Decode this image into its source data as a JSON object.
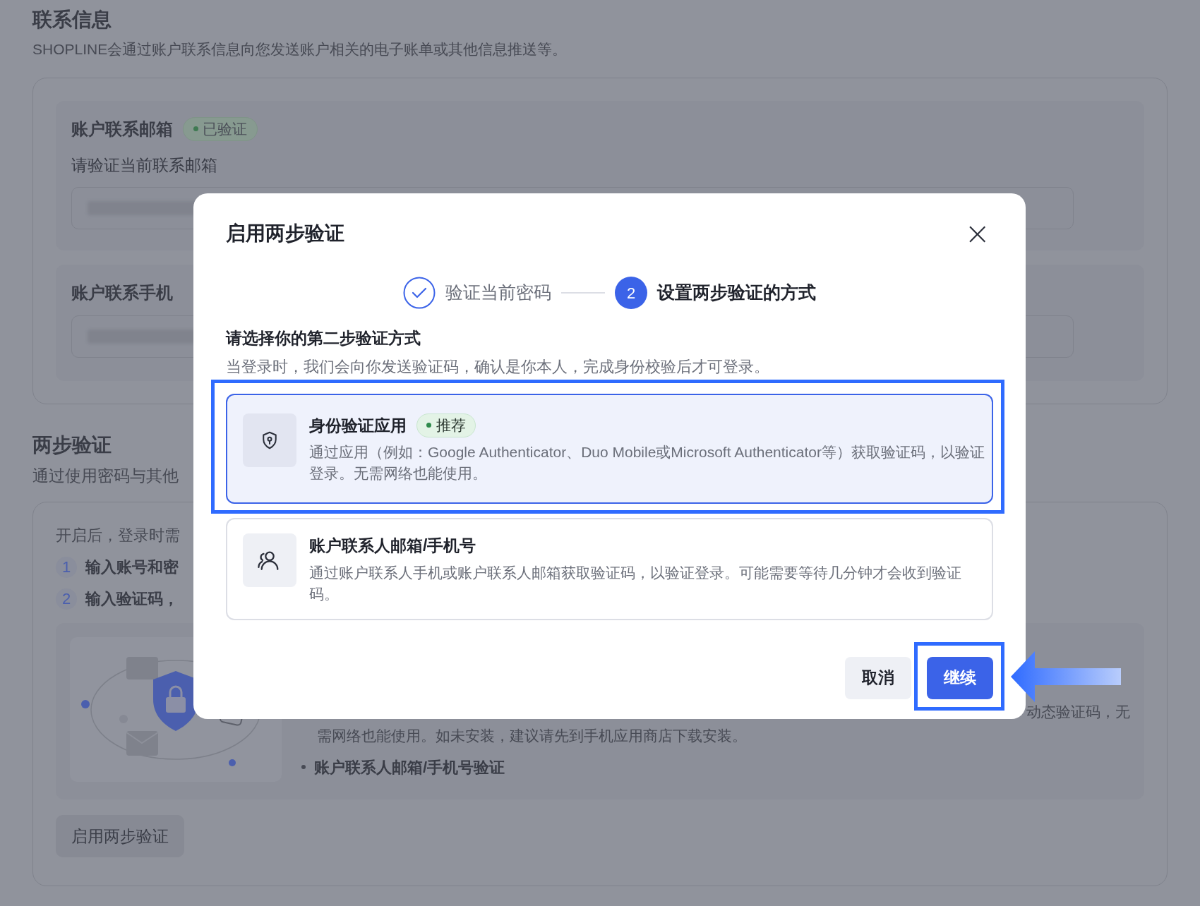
{
  "page": {
    "contact": {
      "title": "联系信息",
      "subtitle": "SHOPLINE会通过账户联系信息向您发送账户相关的电子账单或其他信息推送等。",
      "email": {
        "label": "账户联系邮箱",
        "badge": {
          "text": "已验证",
          "color": "#3f7a52"
        },
        "hint": "请验证当前联系邮箱"
      },
      "phone": {
        "label": "账户联系手机"
      }
    },
    "two_step": {
      "title": "两步验证",
      "subtitle": "通过使用密码与其他",
      "intro": "开启后，登录时需",
      "steps": [
        {
          "number": "1",
          "text": "输入账号和密"
        },
        {
          "number": "2",
          "text": "输入验证码，"
        }
      ],
      "methods_text_1": "动态验证码，无",
      "methods_text_2": "需网络也能使用。如未安装，建议请先到手机应用商店下载安装。",
      "methods_bullet": "账户联系人邮箱/手机号验证",
      "button": "启用两步验证"
    }
  },
  "dialog": {
    "title": "启用两步验证",
    "close": "×",
    "steps": [
      {
        "label": "验证当前密码",
        "kind": "done"
      },
      {
        "number": "2",
        "label": "设置两步验证的方式",
        "kind": "current"
      }
    ],
    "prompt": "请选择你的第二步验证方式",
    "description": "当登录时，我们会向你发送验证码，确认是你本人，完成身份校验后才可登录。",
    "options": [
      {
        "kind": "shield",
        "title": "身份验证应用",
        "badge": {
          "text": "推荐",
          "color": "#2f8a4c"
        },
        "description": "通过应用（例如：Google Authenticator、Duo Mobile或Microsoft Authenticator等）获取验证码，以验证登录。无需网络也能使用。",
        "selected": true
      },
      {
        "kind": "people",
        "title": "账户联系人邮箱/手机号",
        "description": "通过账户联系人手机或账户联系人邮箱获取验证码，以验证登录。可能需要等待几分钟才会收到验证码。",
        "selected": false
      }
    ],
    "buttons": [
      {
        "label": "取消",
        "kind": "secondary"
      },
      {
        "label": "继续",
        "kind": "primary"
      }
    ]
  }
}
